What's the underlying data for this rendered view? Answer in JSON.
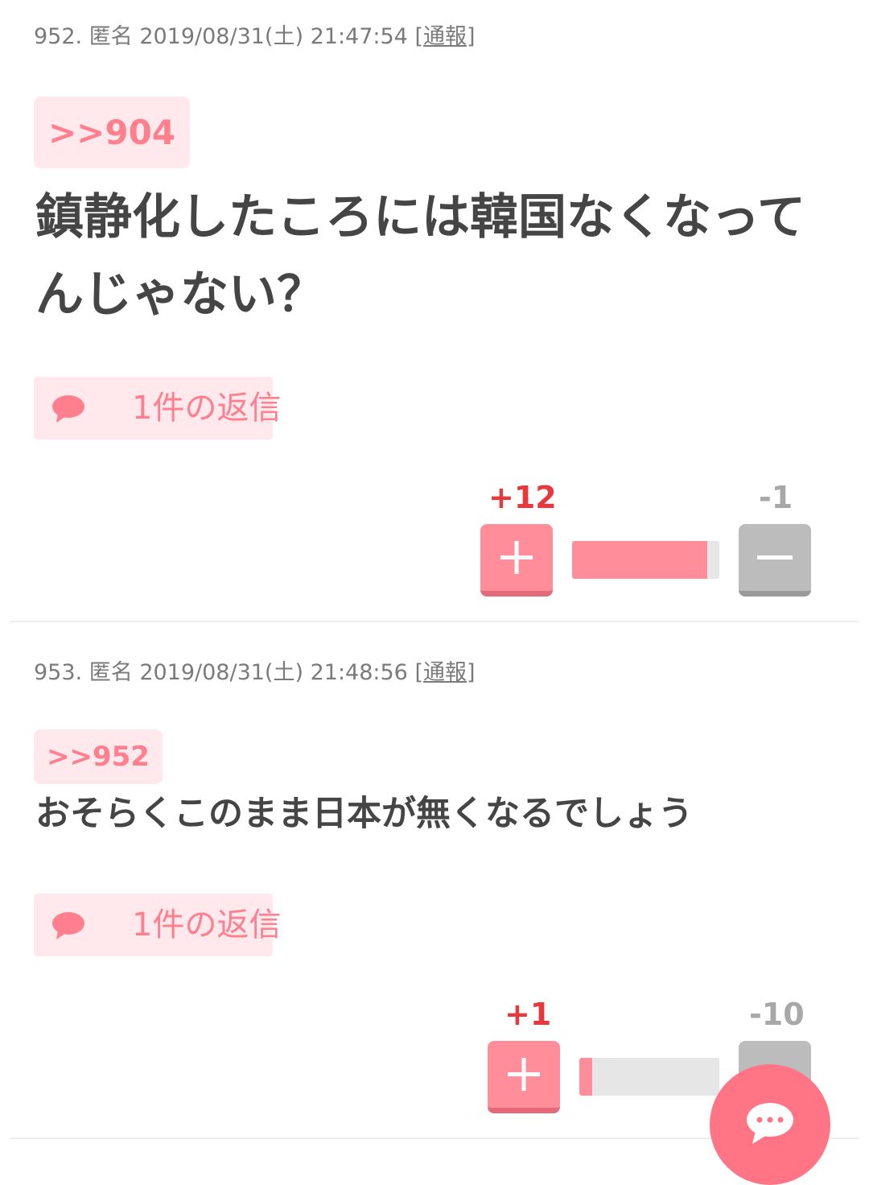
{
  "comments": [
    {
      "number": "952.",
      "author": "匿名",
      "datetime": "2019/08/31(土) 21:47:54",
      "report_label": "通報",
      "anchor": ">>904",
      "body_line1": "鎮静化したころには韓国なくなって",
      "body_line2": "んじゃない？",
      "reply_label": "1件の返信",
      "plus_score": "+12",
      "minus_score": "-1",
      "plus_ratio": 0.92
    },
    {
      "number": "953.",
      "author": "匿名",
      "datetime": "2019/08/31(土) 21:48:56",
      "report_label": "通報",
      "anchor": ">>952",
      "body_line1": "おそらくこのまま日本が無くなるでしょう",
      "reply_label": "1件の返信",
      "plus_score": "+1",
      "minus_score": "-10",
      "plus_ratio": 0.09
    }
  ],
  "colors": {
    "accent_pink": "#ff8d9a",
    "plus_score": "#e8383d",
    "minus_gray": "#bcbcbc"
  },
  "icons": {
    "reply": "speech-bubble-icon",
    "plus": "plus-icon",
    "minus": "minus-icon",
    "fab": "chat-bubble-icon"
  }
}
